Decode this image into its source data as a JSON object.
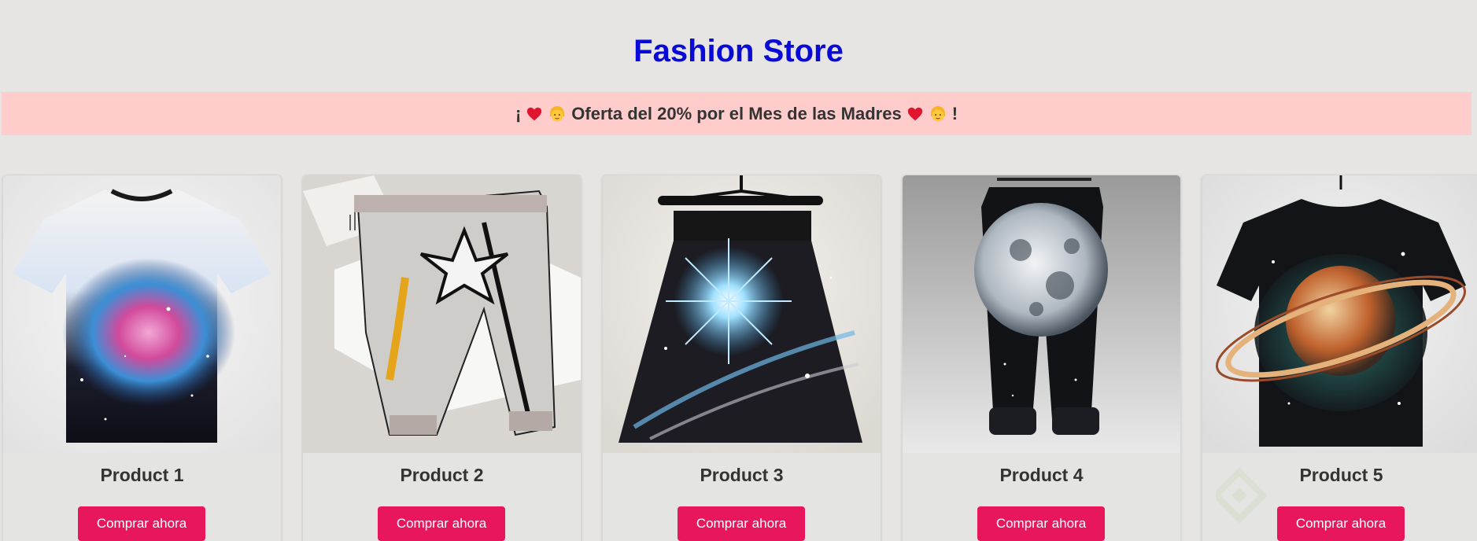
{
  "store": {
    "title": "Fashion Store"
  },
  "promo": {
    "prefix": "¡",
    "text": "Oferta del 20% por el Mes de las Madres",
    "suffix": "!"
  },
  "products": [
    {
      "name": "Product 1",
      "button": "Comprar ahora",
      "image": "galaxy-tshirt-image"
    },
    {
      "name": "Product 2",
      "button": "Comprar ahora",
      "image": "star-pants-image"
    },
    {
      "name": "Product 3",
      "button": "Comprar ahora",
      "image": "starburst-skirt-image"
    },
    {
      "name": "Product 4",
      "button": "Comprar ahora",
      "image": "moon-pants-image"
    },
    {
      "name": "Product 5",
      "button": "Comprar ahora",
      "image": "saturn-tshirt-image"
    }
  ],
  "watermark": {
    "text": "Platzi"
  },
  "colors": {
    "title": "#0a0ad8",
    "promo_bg": "#ffcccc",
    "button": "#e8175d",
    "background": "#e6e5e3"
  }
}
